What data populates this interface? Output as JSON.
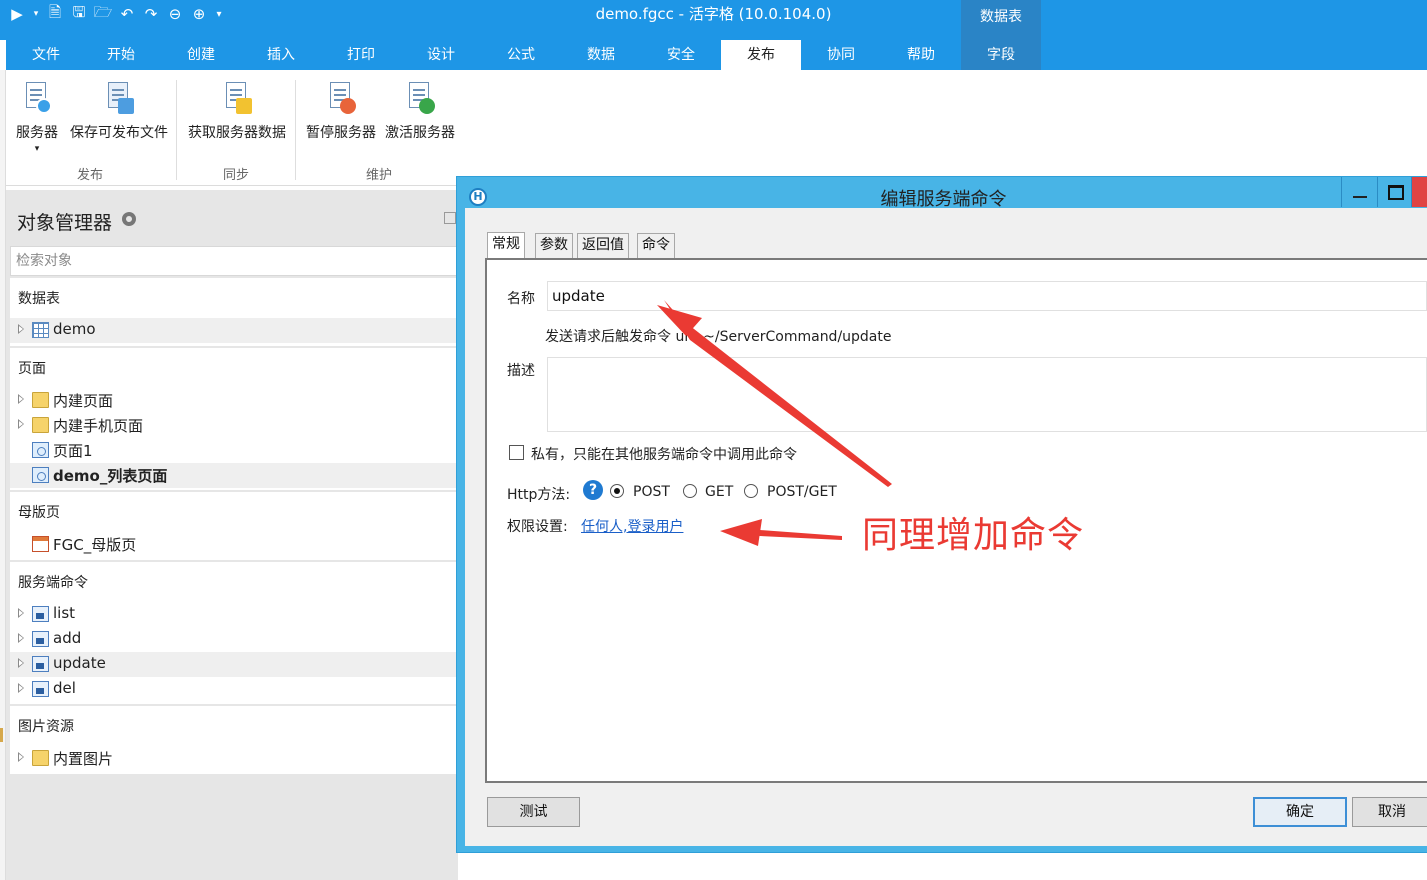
{
  "window": {
    "title": "demo.fgcc - 活字格 (10.0.104.0)"
  },
  "quick_access": [
    "play-icon",
    "dropdown-icon",
    "new-icon",
    "save-icon",
    "open-icon",
    "undo-icon",
    "redo-icon",
    "back-icon",
    "forward-icon",
    "customize-icon"
  ],
  "context_tab": {
    "group": "数据表",
    "tab": "字段"
  },
  "tabs": [
    "文件",
    "开始",
    "创建",
    "插入",
    "打印",
    "设计",
    "公式",
    "数据",
    "安全",
    "发布",
    "协同",
    "帮助"
  ],
  "active_tab": "发布",
  "ribbon": {
    "buttons": [
      {
        "label": "服务器",
        "icon": "server-icon"
      },
      {
        "label": "保存可发布文件",
        "icon": "save-publish-icon"
      },
      {
        "label": "获取服务器数据",
        "icon": "fetch-data-icon"
      },
      {
        "label": "暂停服务器",
        "icon": "pause-server-icon"
      },
      {
        "label": "激活服务器",
        "icon": "activate-server-icon"
      }
    ],
    "groups": [
      "发布",
      "同步",
      "维护"
    ]
  },
  "object_manager": {
    "title": "对象管理器",
    "search_placeholder": "检索对象",
    "sections": {
      "tables": {
        "title": "数据表",
        "items": [
          "demo"
        ]
      },
      "pages": {
        "title": "页面",
        "items": [
          "内建页面",
          "内建手机页面",
          "页面1",
          "demo_列表页面"
        ]
      },
      "masters": {
        "title": "母版页",
        "items": [
          "FGC_母版页"
        ]
      },
      "commands": {
        "title": "服务端命令",
        "items": [
          "list",
          "add",
          "update",
          "del"
        ]
      },
      "images": {
        "title": "图片资源",
        "items": [
          "内置图片"
        ]
      }
    }
  },
  "dialog": {
    "title": "编辑服务端命令",
    "tabs": [
      "常规",
      "参数",
      "返回值",
      "命令"
    ],
    "name_label": "名称",
    "name_value": "update",
    "url_hint": "发送请求后触发命令 url: ~/ServerCommand/update",
    "desc_label": "描述",
    "private_label": "私有，只能在其他服务端命令中调用此命令",
    "private_checked": false,
    "http_label": "Http方法:",
    "http_options": [
      "POST",
      "GET",
      "POST/GET"
    ],
    "http_selected": "POST",
    "perm_label": "权限设置:",
    "perm_value": "任何人,登录用户",
    "test_button": "测试",
    "ok_button": "确定",
    "cancel_button": "取消"
  },
  "annotation": {
    "text": "同理增加命令",
    "color": "#ea3a33"
  },
  "colors": {
    "accent": "#1e96e6",
    "dialog_frame": "#48b4e6",
    "link": "#1a5fc8"
  }
}
